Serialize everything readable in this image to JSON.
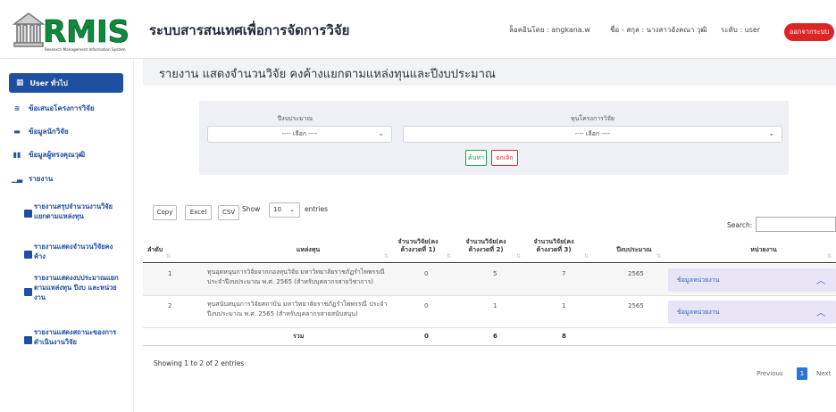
{
  "header": {
    "logo_text": "RMIS",
    "logo_subtitle": "Research Management Information System",
    "title": "ระบบสารสนเทศเพื่อการจัดการวิจัย",
    "login_label": "ล็อคอินโดย : angkana.w",
    "name_label": "ชื่อ - สกุล : นางสาวอังคณา วุฒิ",
    "level_label": "ระดับ : user",
    "logout_label": "ออกจากระบบ"
  },
  "sidebar": {
    "active": {
      "label": "User ทั่วไป",
      "icon": "grid-icon"
    },
    "items": [
      {
        "label": "ข้อเสนอโครงการวิจัย",
        "icon": "layers-icon"
      },
      {
        "label": "ข้อมูลนักวิจัย",
        "icon": "briefcase-icon"
      },
      {
        "label": "ข้อมูลผู้ทรงคุณวุฒิ",
        "icon": "columns-icon"
      },
      {
        "label": "รายงาน",
        "icon": "bar-chart-icon"
      }
    ],
    "subitems": [
      {
        "label": "รายงานสรุปจำนวนงานวิจัยแยกตามแหล่งทุน"
      },
      {
        "label": "รายงานแสดงจำนวนวิจัยคงค้าง"
      },
      {
        "label": "รายงานแสดงงบประมาณแยกตามแหล่งทุน ปีงบ และหน่วยงาน"
      },
      {
        "label": "รายงานแสดงสถานะของการดำเนินงานวิจัย"
      }
    ]
  },
  "page": {
    "title": "รายงาน แสดงจำนวนวิจัย คงค้างแยกตามแหล่งทุนและปีงบประมาณ"
  },
  "filters": {
    "budget_year_label": "ปีงบประมาณ",
    "budget_year_value": "---- เลือก ----",
    "fund_label": "ทุนโครงการวิจัย",
    "fund_value": "---- เลือก ----",
    "search_label": "ค้นหา",
    "cancel_label": "ยกเลิก"
  },
  "toolbar": {
    "copy_label": "Copy",
    "excel_label": "Excel",
    "csv_label": "CSV",
    "show_label": "Show",
    "page_length": "10",
    "entries_label": "entries",
    "search_label": "Search:"
  },
  "table": {
    "headers": {
      "no": "ลำดับ",
      "fund": "แหล่งทุน",
      "pending1": "จำนวนวิจัย(คงค้างงวดที่ 1)",
      "pending2": "จำนวนวิจัย(คงค้างงวดที่ 2)",
      "pending3": "จำนวนวิจัย(คงค้างงวดที่ 3)",
      "year": "ปีงบประมาณ",
      "unit": "หน่วยงาน"
    },
    "rows": [
      {
        "no": "1",
        "fund": "ทุนอุดหนุนการวิจัยจากกองทุนวิจัย มหาวิทยาลัยราชภัฏรำไพพรรณี ประจำปีงบประมาณ พ.ศ. 2565 (สำหรับบุคลากรสายวิชาการ)",
        "pending1": "0",
        "pending2": "5",
        "pending3": "7",
        "year": "2565",
        "unit": "ข้อมูลหน่วยงาน"
      },
      {
        "no": "2",
        "fund": "ทุนสนับสนุนการวิจัยสถาบัน มหาวิทยาลัยราชภัฏรำไพพรรณี ประจำปีงบประมาณ พ.ศ. 2565 (สำหรับบุคลากรสายสนับสนุน)",
        "pending1": "0",
        "pending2": "1",
        "pending3": "1",
        "year": "2565",
        "unit": "ข้อมูลหน่วยงาน"
      }
    ],
    "total": {
      "label": "รวม",
      "pending1": "0",
      "pending2": "6",
      "pending3": "8"
    }
  },
  "footer": {
    "info": "Showing 1 to 2 of 2 entries",
    "previous": "Previous",
    "current_page": "1",
    "next": "Next"
  },
  "colors": {
    "primary": "#1f4fa0",
    "danger": "#dc2626",
    "success": "#16a34a",
    "logo_green": "#0f8a3c"
  }
}
